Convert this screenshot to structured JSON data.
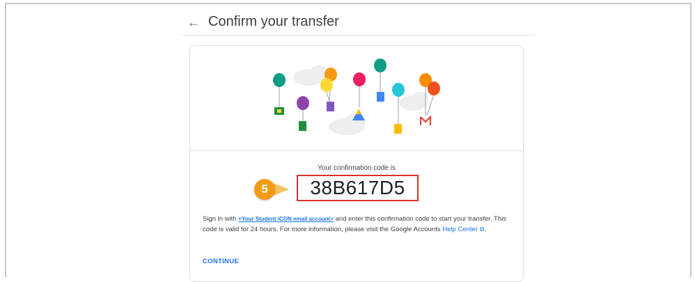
{
  "header": {
    "back_icon": "arrow-left-icon",
    "title": "Confirm your transfer"
  },
  "confirmation": {
    "label": "Your confirmation code is",
    "code": "38B617D5",
    "step_number": "5",
    "step_color": "#f39c12",
    "highlight_color": "#d93025"
  },
  "instructions": {
    "part1": "Sign in with ",
    "account": "<Your Student iCON email account>",
    "part2": " and enter this confirmation code to start your transfer. This code is valid for 24 hours. For more information, please visit the Google Accounts ",
    "help_link": "Help Center",
    "part3": "."
  },
  "actions": {
    "continue_label": "CONTINUE"
  },
  "illustration": {
    "balloon_colors": [
      "#0f9d84",
      "#8e44ad",
      "#f39c12",
      "#fdd835",
      "#e91e63",
      "#0f9d84",
      "#26c6da",
      "#fb8c00",
      "#f4511e"
    ]
  }
}
